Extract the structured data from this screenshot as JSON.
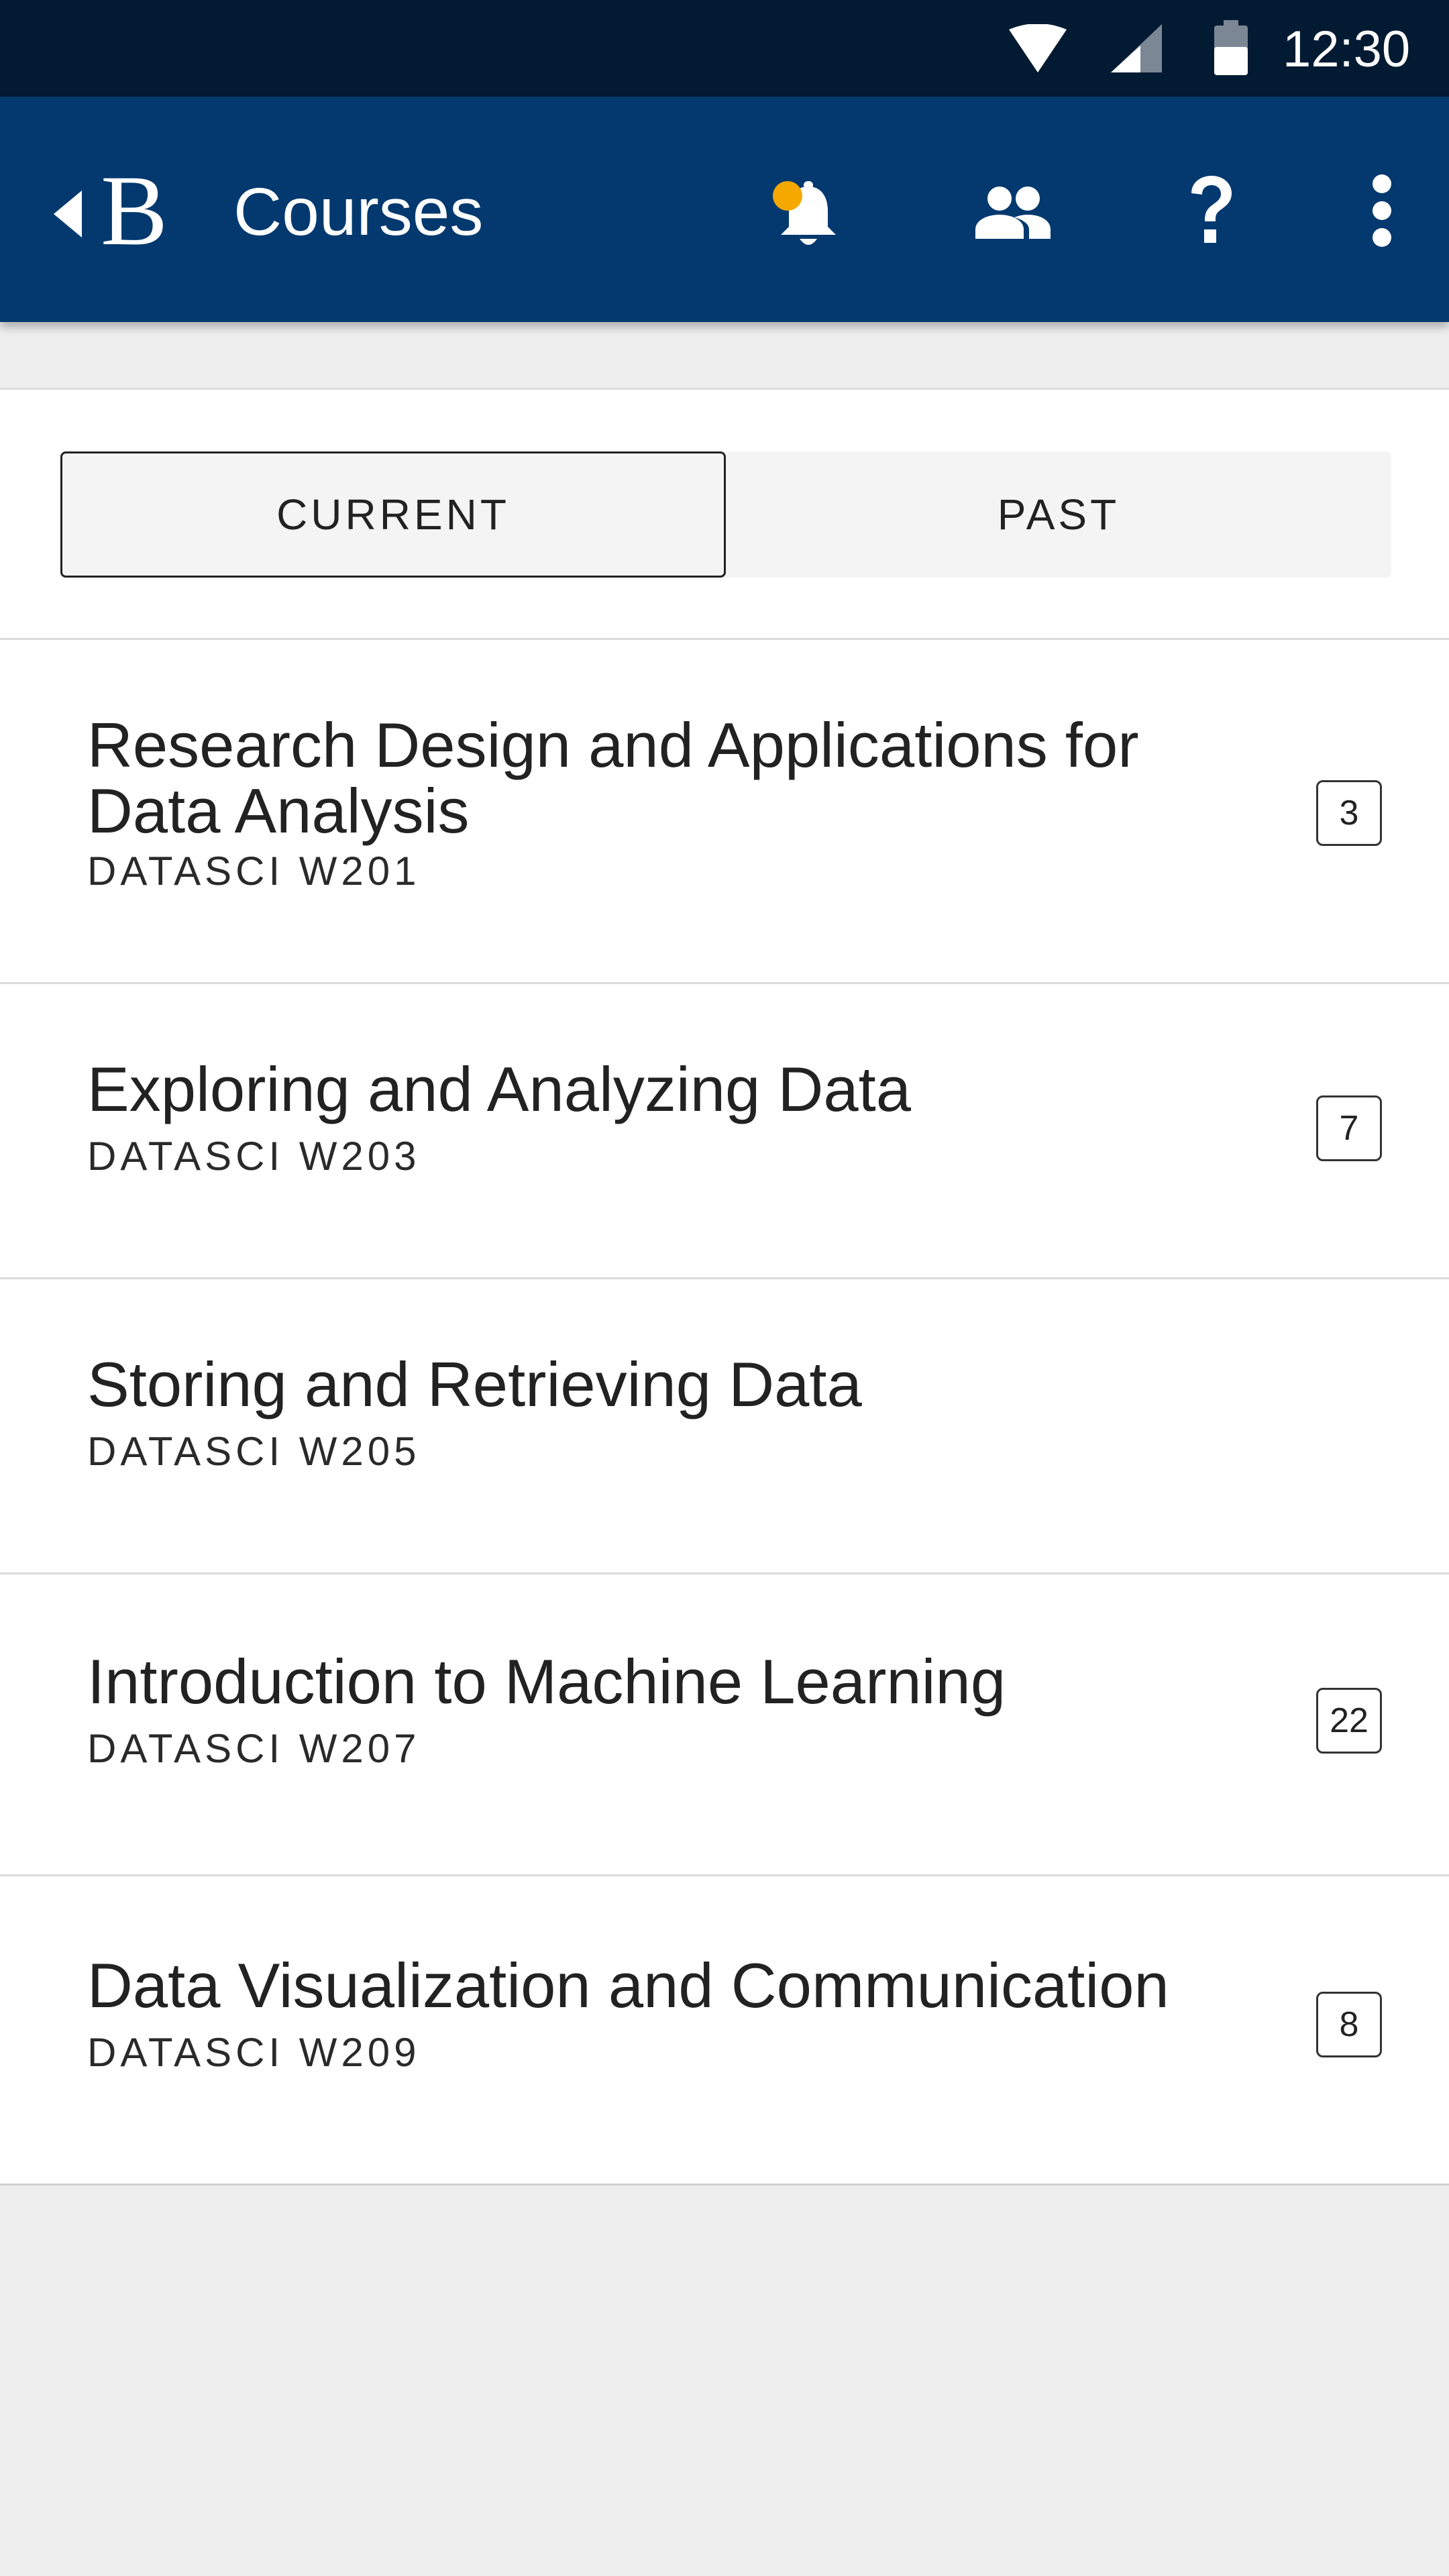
{
  "status_bar": {
    "time": "12:30",
    "icons": [
      "wifi-icon",
      "cell-signal-icon",
      "battery-icon"
    ]
  },
  "app_bar": {
    "logo_letter": "B",
    "title": "Courses",
    "actions": [
      "notifications-icon",
      "people-icon",
      "help-icon",
      "more-vert-icon"
    ],
    "notification_dot_color": "#f5a800"
  },
  "tabs": {
    "current": "CURRENT",
    "past": "PAST",
    "selected": "CURRENT"
  },
  "courses": [
    {
      "title": "Research Design and Applications for Data Analysis",
      "code": "DATASCI W201",
      "count": "3"
    },
    {
      "title": "Exploring and Analyzing Data",
      "code": "DATASCI W203",
      "count": "7"
    },
    {
      "title": "Storing and Retrieving Data",
      "code": "DATASCI W205",
      "count": ""
    },
    {
      "title": "Introduction to Machine Learning",
      "code": "DATASCI W207",
      "count": "22"
    },
    {
      "title": "Data Visualization and Communication",
      "code": "DATASCI W209",
      "count": "8"
    }
  ],
  "colors": {
    "status_bar": "#031a33",
    "app_bar": "#03396f",
    "background": "#eeeeee"
  }
}
